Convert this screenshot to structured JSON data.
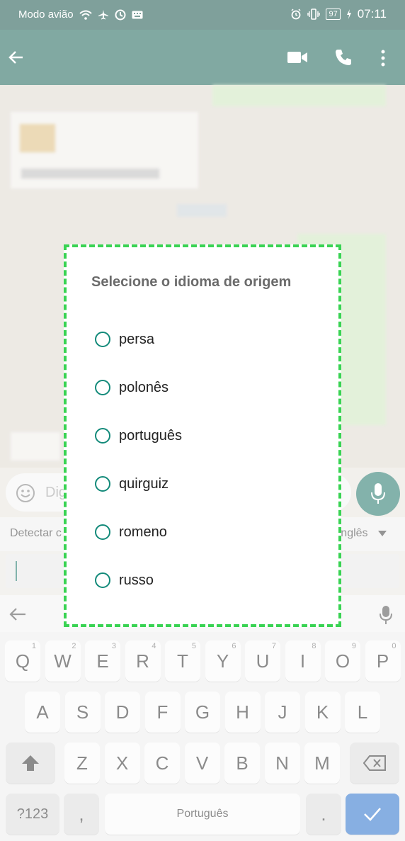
{
  "status_bar": {
    "carrier": "Modo avião",
    "battery": "97",
    "time": "07:11"
  },
  "app_bar": {
    "back_icon": "arrow-left-icon",
    "video_icon": "video-call-icon",
    "call_icon": "phone-icon",
    "menu_icon": "more-vert-icon"
  },
  "composer": {
    "placeholder_visible": "Dig"
  },
  "translate_bar": {
    "left": "Detectar c",
    "right": "nglês"
  },
  "dialog": {
    "title": "Selecione o idioma de origem",
    "options": [
      "persa",
      "polonês",
      "português",
      "quirguiz",
      "romeno",
      "russo"
    ]
  },
  "keyboard": {
    "row1": [
      "Q",
      "W",
      "E",
      "R",
      "T",
      "Y",
      "U",
      "I",
      "O",
      "P"
    ],
    "row1_hints": [
      "1",
      "2",
      "3",
      "4",
      "5",
      "6",
      "7",
      "8",
      "9",
      "0"
    ],
    "row2": [
      "A",
      "S",
      "D",
      "F",
      "G",
      "H",
      "J",
      "K",
      "L"
    ],
    "row3": [
      "Z",
      "X",
      "C",
      "V",
      "B",
      "N",
      "M"
    ],
    "symbols": "?123",
    "comma": ",",
    "space": "Português",
    "period": "."
  },
  "colors": {
    "accent": "#138a7a",
    "dialog_border": "#39d353",
    "enter": "#1a66c8"
  }
}
